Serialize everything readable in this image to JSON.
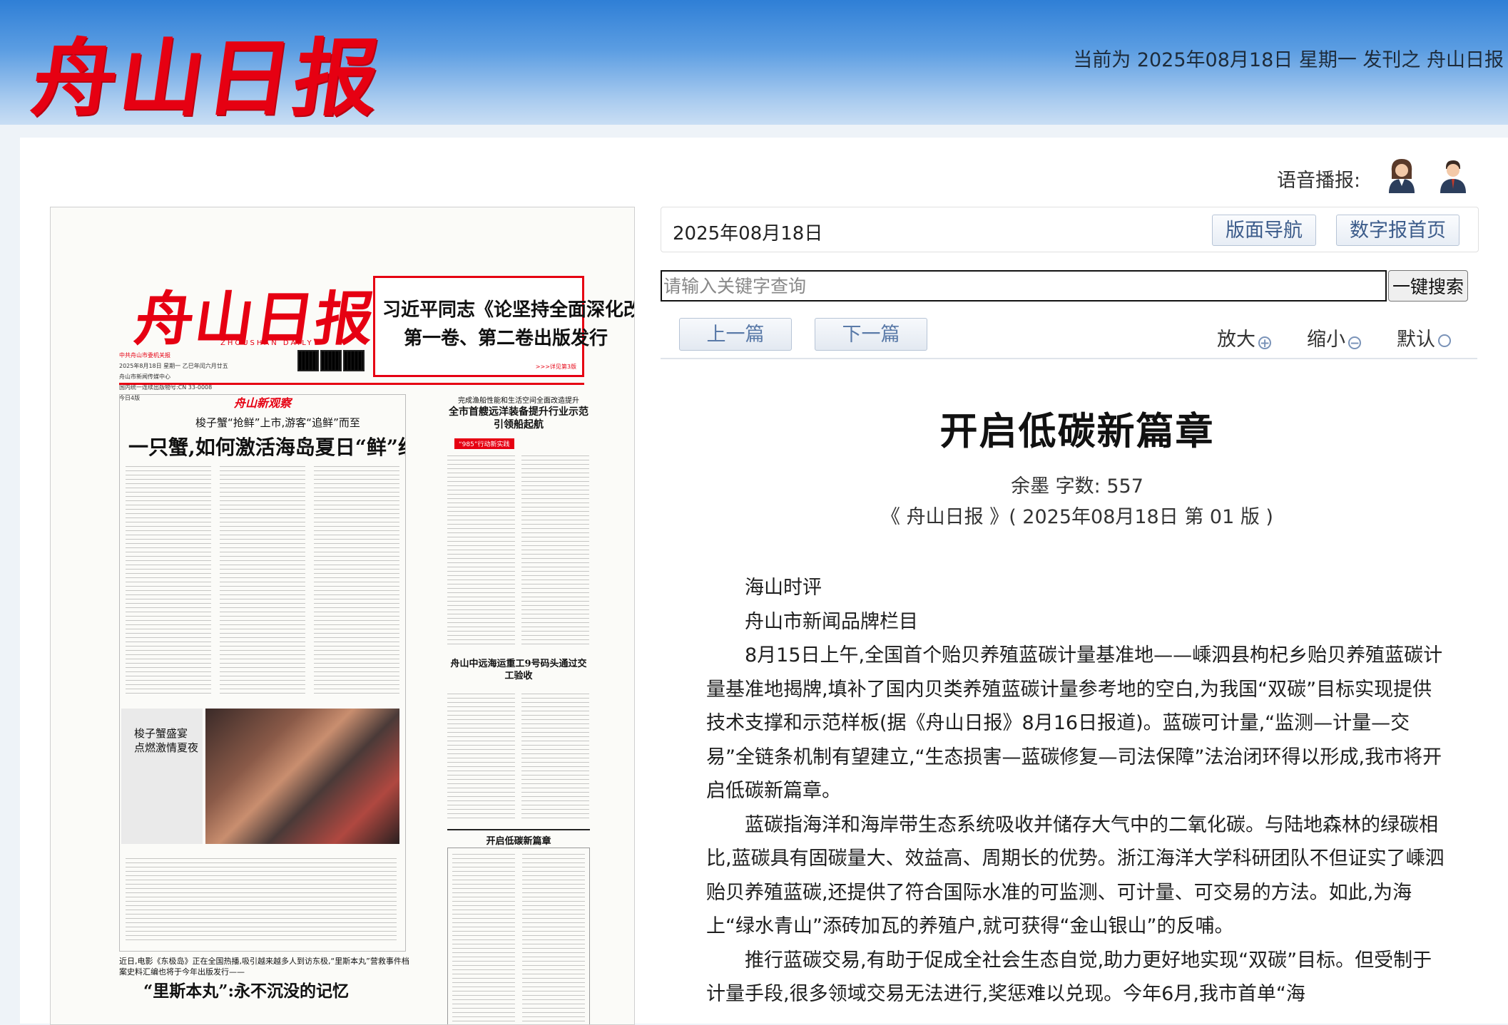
{
  "header": {
    "logo_text": "舟山日报",
    "issue_info": "当前为 2025年08月18日 星期一 发刊之 舟山日报"
  },
  "voice": {
    "label": "语音播报:",
    "female_icon": "female-anchor-icon",
    "male_icon": "male-anchor-icon"
  },
  "toolbar": {
    "current_date": "2025年08月18日",
    "page_nav_label": "版面导航",
    "digital_home_label": "数字报首页",
    "search_placeholder": "请输入关键字查询",
    "search_button": "一键搜索",
    "prev_label": "上一篇",
    "next_label": "下一篇",
    "zoom_in_label": "放大",
    "zoom_out_label": "缩小",
    "zoom_default_label": "默认"
  },
  "paper_page": {
    "masthead": "舟山日报",
    "masthead_en": "ZHOUSHAN DAILY",
    "meta_lines": [
      "中共舟山市委机关报",
      "2025年8月18日 星期一 乙巳年闰六月廿五",
      "舟山市新闻传媒中心",
      "国内统一连续出版物号:CN 33-0008",
      "今日4版"
    ],
    "promo_line1": "习近平同志《论坚持全面深化改革》",
    "promo_line2": "第一卷、第二卷出版发行",
    "promo_more": ">>>详见第3版",
    "lead_brand": "舟山新观察",
    "lead_kicker": "梭子蟹“抢鲜”上市,游客“追鲜”而至",
    "lead_title": "一只蟹,如何激活海岛夏日“鲜”经济",
    "photo_caption": [
      "梭子蟹盛宴",
      "点燃激情夏夜"
    ],
    "bottom_kicker": "近日,电影《东极岛》正在全国热播,吸引越来越多人到访东极,“里斯本丸”营救事件档案史料汇编也将于今年出版发行——",
    "bottom_title": "“里斯本丸”:永不沉没的记忆",
    "right_kicker": "完成渔船性能和生活空间全面改造提升",
    "right_title": "全市首艘远洋装备提升行业示范引领船起航",
    "right_tag": "“985”行动新实践",
    "right_title2": "舟山中远海运重工9号码头通过交工验收",
    "right_title3": "开启低碳新篇章"
  },
  "article": {
    "title": "开启低碳新篇章",
    "byline": "余墨 字数: 557",
    "source": "《 舟山日报 》( 2025年08月18日 第 01 版 )",
    "paragraphs": [
      "海山时评",
      "舟山市新闻品牌栏目",
      "8月15日上午,全国首个贻贝养殖蓝碳计量基准地——嵊泗县枸杞乡贻贝养殖蓝碳计量基准地揭牌,填补了国内贝类养殖蓝碳计量参考地的空白,为我国“双碳”目标实现提供技术支撑和示范样板(据《舟山日报》8月16日报道)。蓝碳可计量,“监测—计量—交易”全链条机制有望建立,“生态损害—蓝碳修复—司法保障”法治闭环得以形成,我市将开启低碳新篇章。",
      "蓝碳指海洋和海岸带生态系统吸收并储存大气中的二氧化碳。与陆地森林的绿碳相比,蓝碳具有固碳量大、效益高、周期长的优势。浙江海洋大学科研团队不但证实了嵊泗贻贝养殖蓝碳,还提供了符合国际水准的可监测、可计量、可交易的方法。如此,为海上“绿水青山”添砖加瓦的养殖户,就可获得“金山银山”的反哺。",
      "推行蓝碳交易,有助于促成全社会生态自觉,助力更好地实现“双碳”目标。但受制于计量手段,很多领域交易无法进行,奖惩难以兑现。今年6月,我市首单“海"
    ]
  },
  "colors": {
    "brand_red": "#e60012",
    "header_blue": "#3d86d9",
    "button_text": "#3b5b8a"
  }
}
